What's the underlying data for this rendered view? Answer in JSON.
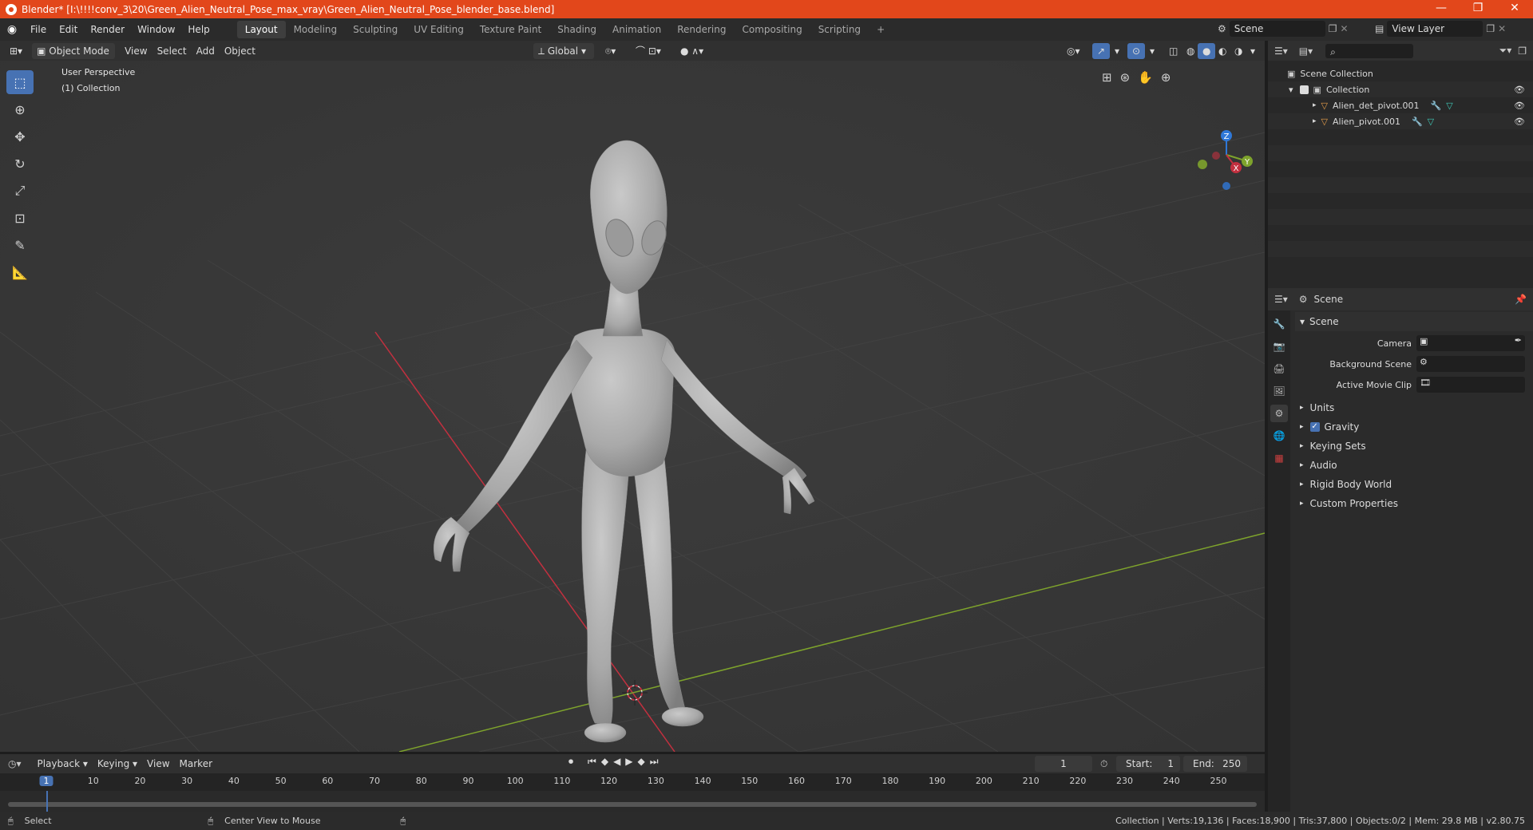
{
  "window": {
    "title": "Blender* [I:\\!!!!conv_3\\20\\Green_Alien_Neutral_Pose_max_vray\\Green_Alien_Neutral_Pose_blender_base.blend]",
    "minimize": "—",
    "maximize": "❐",
    "close": "✕"
  },
  "menu": [
    "File",
    "Edit",
    "Render",
    "Window",
    "Help"
  ],
  "workspaces": [
    "Layout",
    "Modeling",
    "Sculpting",
    "UV Editing",
    "Texture Paint",
    "Shading",
    "Animation",
    "Rendering",
    "Compositing",
    "Scripting"
  ],
  "add_workspace": "+",
  "scene_field": "Scene",
  "view_layer_field": "View Layer",
  "viewport_header": {
    "mode": "Object Mode",
    "view": "View",
    "select": "Select",
    "add": "Add",
    "object": "Object",
    "orientation": "Global"
  },
  "viewport": {
    "perspective": "User Perspective",
    "collection": "(1) Collection",
    "gizmo": {
      "x": "X",
      "y": "Y",
      "z": "Z"
    }
  },
  "outliner": {
    "root": "Scene Collection",
    "collection": "Collection",
    "objects": [
      "Alien_det_pivot.001",
      "Alien_pivot.001"
    ]
  },
  "properties": {
    "header": "Scene",
    "panel": "Scene",
    "fields": [
      {
        "label": "Camera"
      },
      {
        "label": "Background Scene"
      },
      {
        "label": "Active Movie Clip"
      }
    ],
    "sections": [
      "Units",
      "Gravity",
      "Keying Sets",
      "Audio",
      "Rigid Body World",
      "Custom Properties"
    ]
  },
  "timeline": {
    "playback": "Playback",
    "keying": "Keying",
    "view": "View",
    "marker": "Marker",
    "current_frame": "1",
    "start_label": "Start:",
    "start": "1",
    "end_label": "End:",
    "end": "250",
    "ticks": [
      "1",
      "10",
      "20",
      "30",
      "40",
      "50",
      "60",
      "70",
      "80",
      "90",
      "100",
      "110",
      "120",
      "130",
      "140",
      "150",
      "160",
      "170",
      "180",
      "190",
      "200",
      "210",
      "220",
      "230",
      "240",
      "250"
    ]
  },
  "status": {
    "select": "Select",
    "center_view": "Center View to Mouse",
    "stats": "Collection | Verts:19,136 | Faces:18,900 | Tris:37,800 | Objects:0/2 | Mem: 29.8 MB | v2.80.75"
  },
  "colors": {
    "title_bar": "#e2471b",
    "active_tool": "#4772b3",
    "x_axis": "#c2303f",
    "y_axis": "#7ea32c",
    "z_axis": "#2f78d8"
  }
}
